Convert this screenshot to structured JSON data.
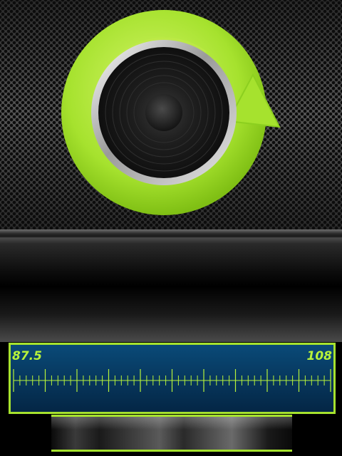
{
  "theme": {
    "accent": "#a6e22e",
    "panel": "#063459",
    "frequency_text": "#b7f23a"
  },
  "logo": {
    "icon": "speaker-refresh-icon"
  },
  "tuner": {
    "min_label": "87.5",
    "max_label": "108",
    "min_value": 87.5,
    "max_value": 108
  },
  "bottom_bar": {
    "icon": "control-bar"
  }
}
